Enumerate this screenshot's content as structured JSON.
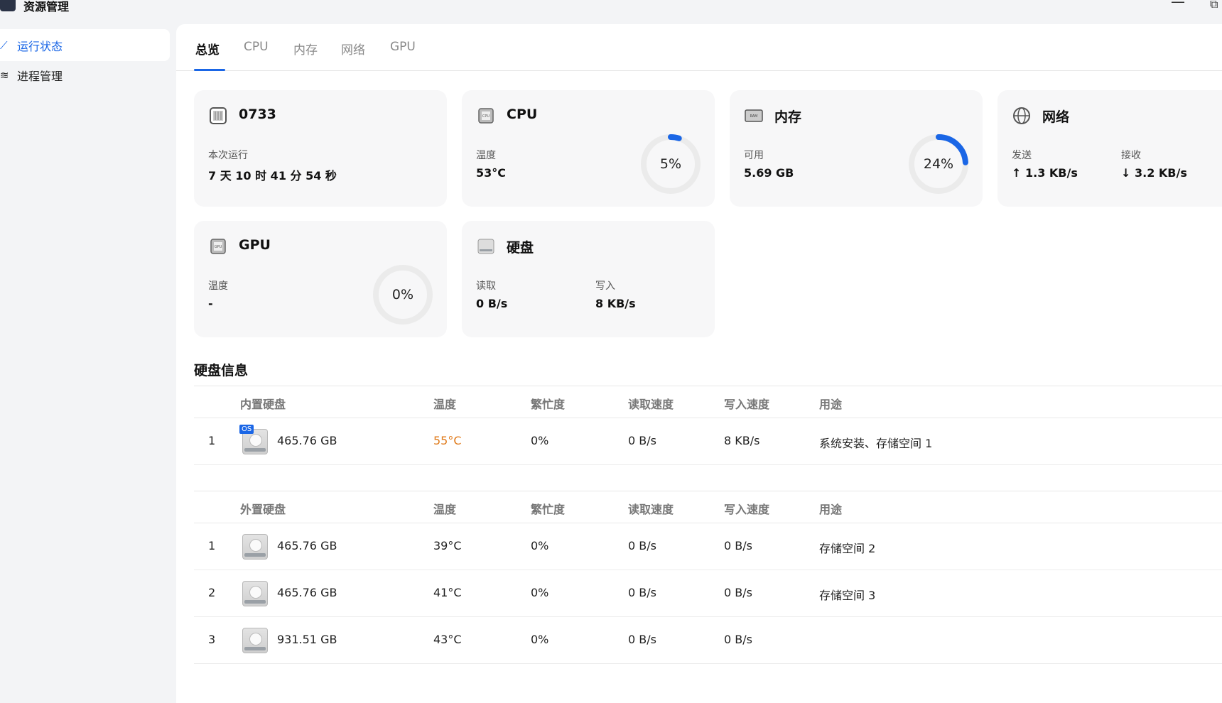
{
  "app": {
    "title": "资源管理"
  },
  "sidebar": {
    "items": [
      {
        "label": "运行状态",
        "icon": "chart-line-icon",
        "active": true
      },
      {
        "label": "进程管理",
        "icon": "layers-icon",
        "active": false
      }
    ]
  },
  "tabs": [
    {
      "label": "总览",
      "active": true
    },
    {
      "label": "CPU",
      "active": false
    },
    {
      "label": "内存",
      "active": false
    },
    {
      "label": "网络",
      "active": false
    },
    {
      "label": "GPU",
      "active": false
    }
  ],
  "cards": {
    "system": {
      "title": "0733",
      "uptime_label": "本次运行",
      "uptime_value": "7 天 10 时 41 分 54 秒"
    },
    "cpu": {
      "title": "CPU",
      "temp_label": "温度",
      "temp_value": "53°C",
      "usage_text": "5%",
      "usage": 0.05
    },
    "memory": {
      "title": "内存",
      "avail_label": "可用",
      "avail_value": "5.69 GB",
      "usage_text": "24%",
      "usage": 0.24
    },
    "network": {
      "title": "网络",
      "send_label": "发送",
      "send_value": "1.3 KB/s",
      "recv_label": "接收",
      "recv_value": "3.2 KB/s"
    },
    "gpu": {
      "title": "GPU",
      "temp_label": "温度",
      "temp_value": "-",
      "usage_text": "0%",
      "usage": 0
    },
    "disk": {
      "title": "硬盘",
      "read_label": "读取",
      "read_value": "0 B/s",
      "write_label": "写入",
      "write_value": "8 KB/s"
    }
  },
  "disk_info": {
    "title": "硬盘信息",
    "internal": {
      "headers": [
        "内置硬盘",
        "温度",
        "繁忙度",
        "读取速度",
        "写入速度",
        "用途"
      ],
      "rows": [
        {
          "index": "1",
          "badge": "OS",
          "capacity": "465.76 GB",
          "temp": "55°C",
          "busy": "0%",
          "read": "0 B/s",
          "write": "8 KB/s",
          "usage": "系统安装、存储空间 1"
        }
      ]
    },
    "external": {
      "headers": [
        "外置硬盘",
        "温度",
        "繁忙度",
        "读取速度",
        "写入速度",
        "用途"
      ],
      "rows": [
        {
          "index": "1",
          "capacity": "465.76 GB",
          "temp": "39°C",
          "busy": "0%",
          "read": "0 B/s",
          "write": "0 B/s",
          "usage": "存储空间 2"
        },
        {
          "index": "2",
          "capacity": "465.76 GB",
          "temp": "41°C",
          "busy": "0%",
          "read": "0 B/s",
          "write": "0 B/s",
          "usage": "存储空间 3"
        },
        {
          "index": "3",
          "capacity": "931.51 GB",
          "temp": "43°C",
          "busy": "0%",
          "read": "0 B/s",
          "write": "0 B/s",
          "usage": ""
        }
      ]
    }
  },
  "colors": {
    "accent": "#1a66e6",
    "warm": "#e07a1a"
  }
}
